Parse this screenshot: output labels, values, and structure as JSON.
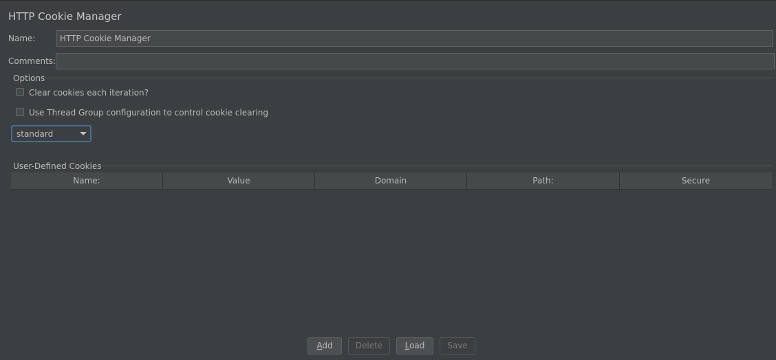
{
  "title": "HTTP Cookie Manager",
  "name_label": "Name:",
  "name_value": "HTTP Cookie Manager",
  "comments_label": "Comments:",
  "comments_value": "",
  "options": {
    "title": "Options",
    "clear_each_iteration": {
      "label": "Clear cookies each iteration?",
      "checked": false
    },
    "use_thread_group": {
      "label": "Use Thread Group configuration to control cookie clearing",
      "checked": false
    },
    "policy": {
      "selected": "standard"
    }
  },
  "cookies": {
    "title": "User-Defined Cookies",
    "columns": [
      "Name:",
      "Value",
      "Domain",
      "Path:",
      "Secure"
    ],
    "rows": []
  },
  "buttons": {
    "add": {
      "mnemonic": "A",
      "rest": "dd"
    },
    "delete": {
      "label": "Delete"
    },
    "load": {
      "mnemonic": "L",
      "rest": "oad"
    },
    "save": {
      "label": "Save"
    }
  }
}
